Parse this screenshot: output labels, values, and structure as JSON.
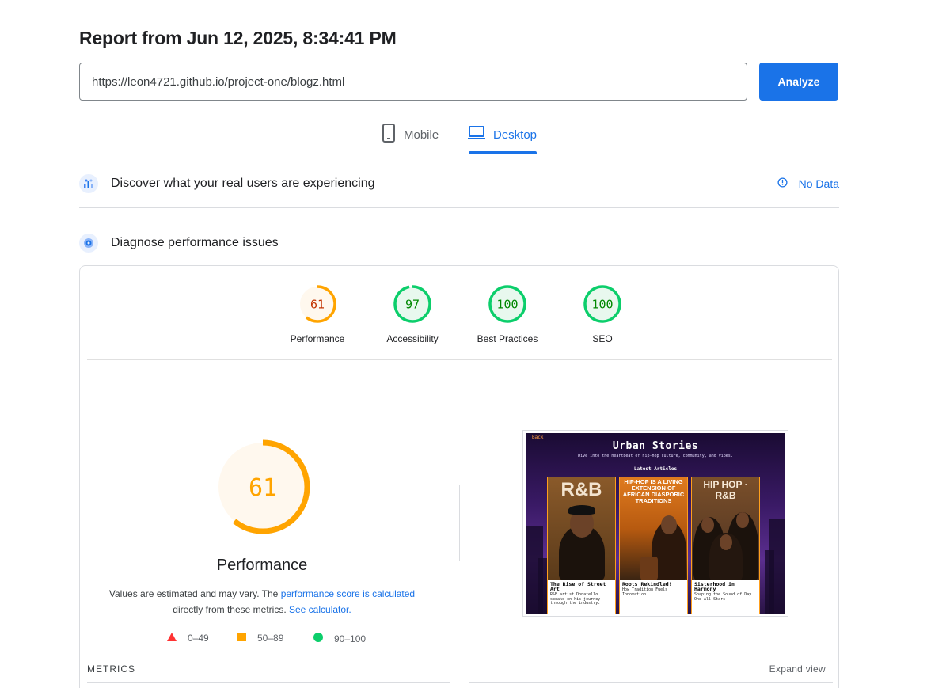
{
  "report": {
    "title": "Report from Jun 12, 2025, 8:34:41 PM",
    "url_value": "https://leon4721.github.io/project-one/blogz.html",
    "analyze_label": "Analyze"
  },
  "tabs": [
    {
      "label": "Mobile",
      "icon": "phone-icon",
      "selected": false
    },
    {
      "label": "Desktop",
      "icon": "laptop-icon",
      "selected": true
    }
  ],
  "field_data": {
    "title": "Discover what your real users are experiencing",
    "status": "No Data"
  },
  "diagnose": {
    "title": "Diagnose performance issues"
  },
  "scores": [
    {
      "label": "Performance",
      "value": "61",
      "score": 61,
      "rating": "average"
    },
    {
      "label": "Accessibility",
      "value": "97",
      "score": 97,
      "rating": "pass"
    },
    {
      "label": "Best Practices",
      "value": "100",
      "score": 100,
      "rating": "pass"
    },
    {
      "label": "SEO",
      "value": "100",
      "score": 100,
      "rating": "pass"
    }
  ],
  "performance": {
    "score_text": "61",
    "score": 61,
    "label": "Performance",
    "note_prefix": "Values are estimated and may vary. The",
    "note_link1": "performance score is calculated",
    "note_middle": "directly from these metrics.",
    "note_link2": "See calculator."
  },
  "legend": [
    {
      "range": "0–49",
      "shape": "triangle",
      "color": "#ff3333"
    },
    {
      "range": "50–89",
      "shape": "square",
      "color": "#ffa400"
    },
    {
      "range": "90–100",
      "shape": "circle",
      "color": "#0cce6b"
    }
  ],
  "metrics": {
    "label": "METRICS",
    "expand": "Expand view"
  },
  "colors": {
    "accent": "#1a73e8",
    "average": "#ffa400",
    "pass": "#0cce6b",
    "pass_text": "#008800",
    "average_text": "#c33300"
  },
  "screenshot": {
    "back": "Back",
    "title": "Urban Stories",
    "subtitle": "Dive into the heartbeat of hip-hop culture, community, and vibes.",
    "section": "Latest Articles",
    "articles": [
      {
        "image_heading": "R&B",
        "title": "The Rise of Street Art",
        "text": "R&B artist Donatello speaks on his journey through the industry."
      },
      {
        "image_heading": "HIP-HOP IS A LIVING EXTENSION OF AFRICAN DIASPORIC TRADITIONS",
        "title": "Roots Rekindled!",
        "text": "How Tradition Fuels Innovation"
      },
      {
        "image_heading": "HIP HOP · R&B",
        "title": "Sisterhood in Harmony",
        "text": "Shaping the Sound of Day One All-Stars"
      }
    ]
  }
}
